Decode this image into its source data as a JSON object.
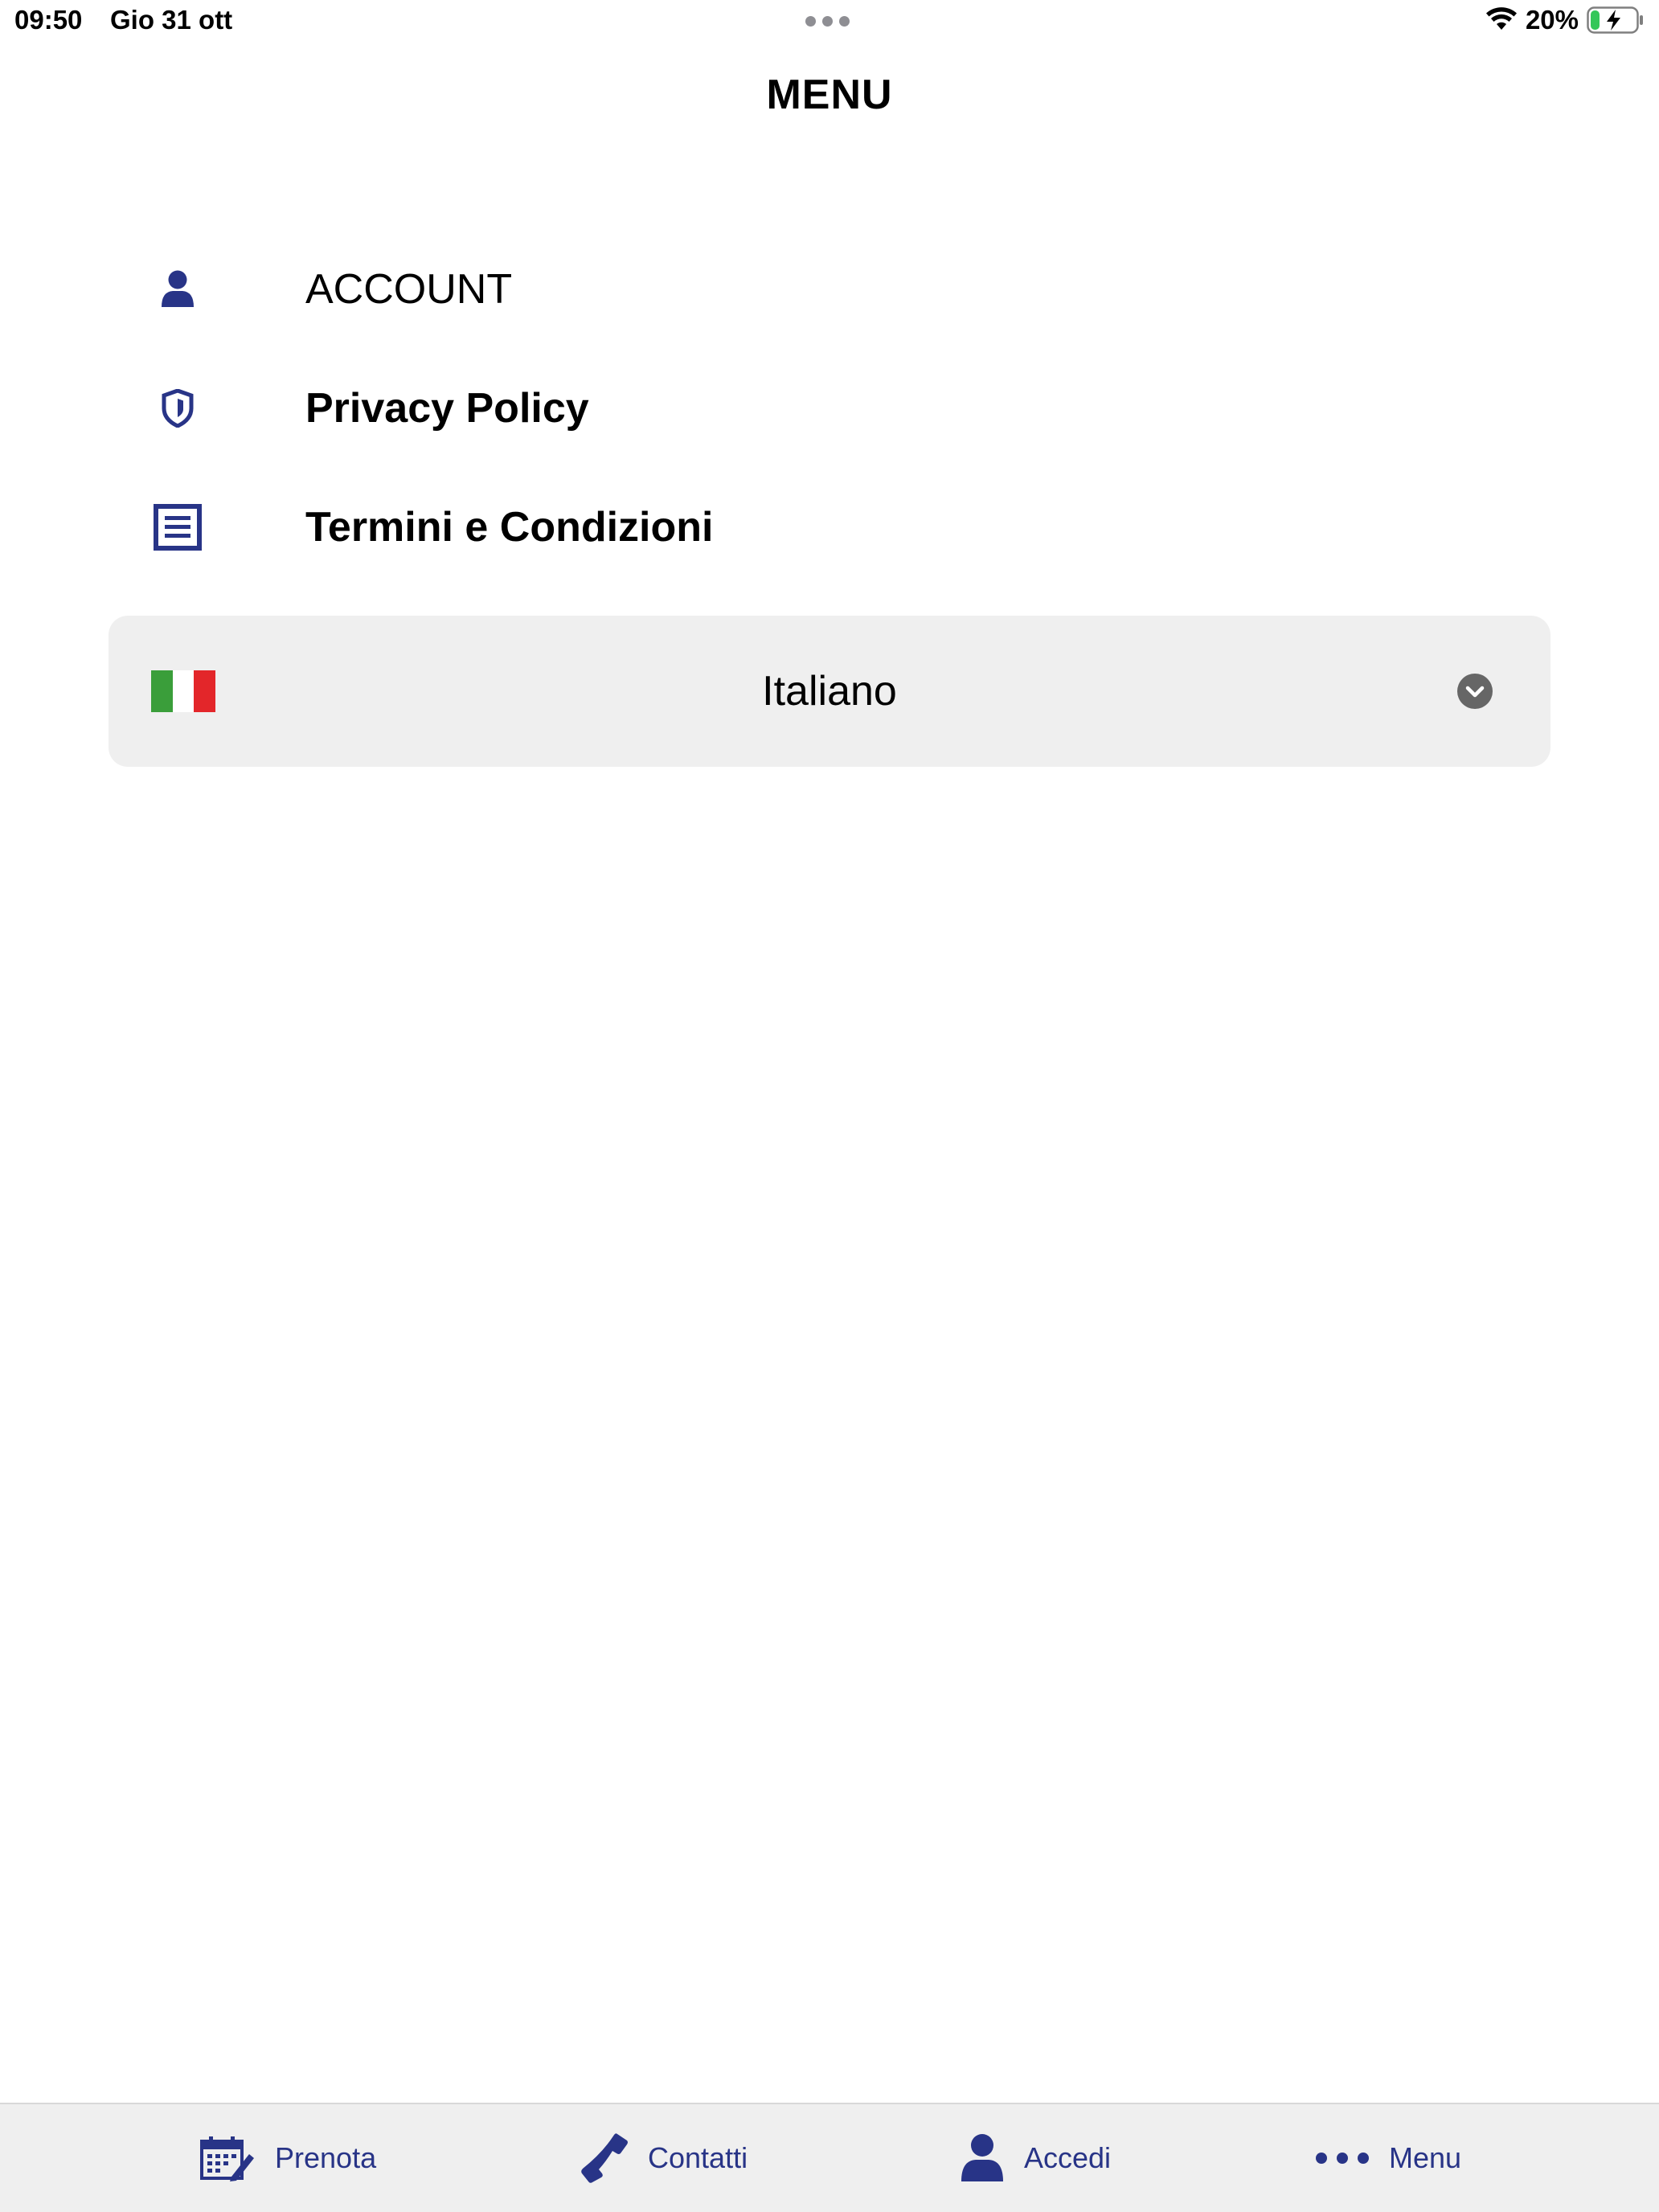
{
  "status_bar": {
    "time": "09:50",
    "date": "Gio 31 ott",
    "battery_percent": "20%",
    "battery_level": 0.2
  },
  "header": {
    "title": "MENU"
  },
  "menu": {
    "items": [
      {
        "label": "ACCOUNT",
        "icon": "user-icon"
      },
      {
        "label": "Privacy Policy",
        "icon": "shield-icon"
      },
      {
        "label": "Termini e Condizioni",
        "icon": "document-icon"
      }
    ]
  },
  "language": {
    "selected": "Italiano",
    "flag_icon": "italy-flag-icon"
  },
  "tab_bar": {
    "tabs": [
      {
        "label": "Prenota",
        "icon": "calendar-edit-icon"
      },
      {
        "label": "Contatti",
        "icon": "phone-icon"
      },
      {
        "label": "Accedi",
        "icon": "user-icon"
      },
      {
        "label": "Menu",
        "icon": "more-dots-icon"
      }
    ]
  },
  "colors": {
    "accent": "#283487",
    "select_background": "#efefef",
    "flag_green": "#3a9e3a",
    "flag_white": "#ffffff",
    "flag_red": "#e3262a",
    "chevron_circle": "#666666"
  }
}
